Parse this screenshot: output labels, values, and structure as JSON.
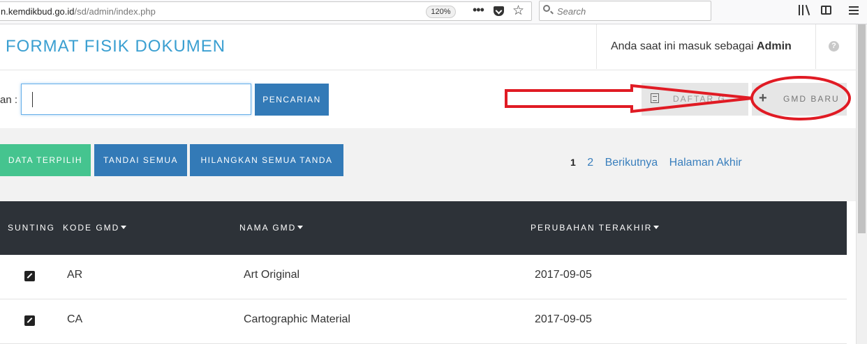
{
  "browser": {
    "url_prefix": "n.kemdikbud.go.id",
    "url_path": "/sd/admin/index.php",
    "zoom": "120%",
    "search_placeholder": "Search"
  },
  "header": {
    "title": "FORMAT FISIK DOKUMEN",
    "login_text": "Anda saat ini masuk sebagai",
    "login_user": "Admin",
    "help_glyph": "?"
  },
  "search": {
    "label": "an :",
    "value": "",
    "button": "PENCARIAN"
  },
  "actions": {
    "list_gmd": "DAFTAR G",
    "new_gmd": "GMD BARU",
    "delete_selected": "DATA TERPILIH",
    "mark_all": "TANDAI SEMUA",
    "unmark_all": "HILANGKAN SEMUA TANDA"
  },
  "pagination": {
    "current": "1",
    "page2": "2",
    "next": "Berikutnya",
    "last": "Halaman Akhir"
  },
  "table": {
    "columns": [
      "SUNTING",
      "KODE GMD",
      "NAMA GMD",
      "PERUBAHAN TERAKHIR"
    ],
    "rows": [
      {
        "code": "AR",
        "name": "Art Original",
        "updated": "2017-09-05"
      },
      {
        "code": "CA",
        "name": "Cartographic Material",
        "updated": "2017-09-05"
      }
    ]
  },
  "colors": {
    "title": "#3a9fd1",
    "primary_button": "#337ab7",
    "success_button": "#45c48f",
    "table_header": "#2d3238",
    "annotation": "#e01b24"
  }
}
